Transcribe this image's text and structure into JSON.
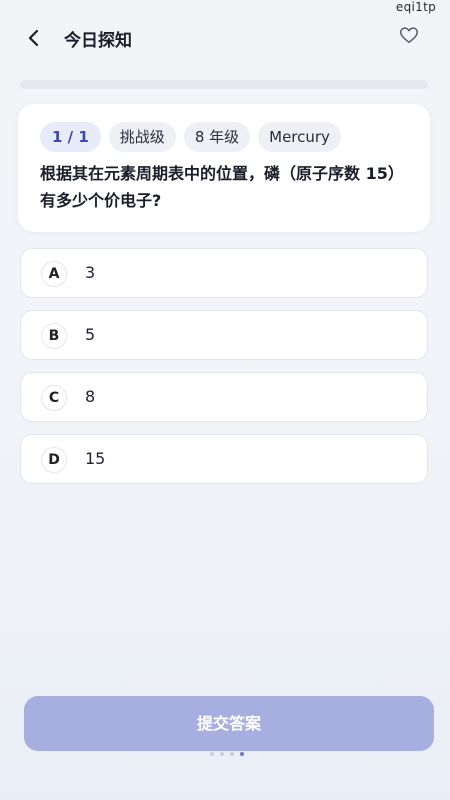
{
  "watermark": "eqi1tp",
  "header": {
    "title": "今日探知",
    "back_icon": "chevron-left-icon",
    "favorite_icon": "heart-outline-icon"
  },
  "progress": {
    "current": 1,
    "total": 1,
    "fraction": 1.0
  },
  "question": {
    "counter": "1 / 1",
    "difficulty": "挑战级",
    "grade": "8 年级",
    "subject": "Mercury",
    "text": "根据其在元素周期表中的位置，磷（原子序数 15）有多少个价电子?"
  },
  "options": [
    {
      "letter": "A",
      "text": "3"
    },
    {
      "letter": "B",
      "text": "5"
    },
    {
      "letter": "C",
      "text": "8"
    },
    {
      "letter": "D",
      "text": "15"
    }
  ],
  "submit_label": "提交答案",
  "colors": {
    "accent": "#a7afe0",
    "counter_text": "#3b48a8"
  }
}
